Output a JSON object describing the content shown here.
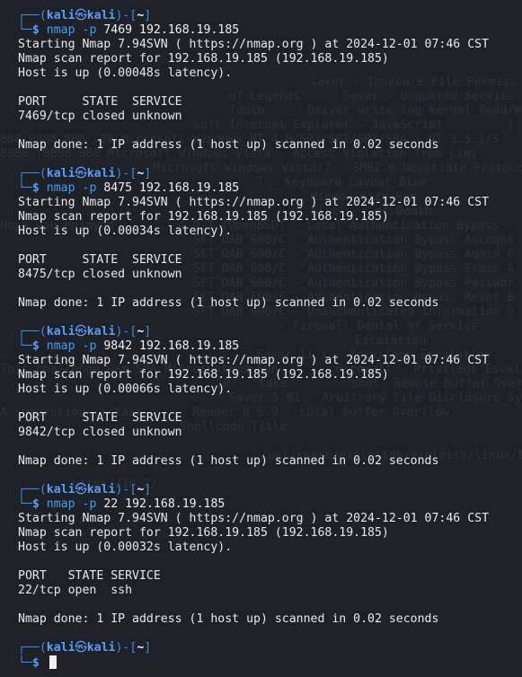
{
  "ghost": {
    "lines": [
      "saver - Insecure File Permiss",
      "of Legends      Saver - Unquoted Service Path",
      "Touch      Driver write_log Kernel Read/Wri",
      "soft Internet Explorer - JavaScript         | D",
      "888 8888 888 .30 Microsoft Windows NT 4.0/SP1/SP2/SP3/SP4 / NT 3.5.1/S",
      "8888 Y8888 888 Microsoft Windows Vista - Access Violation from Limi",
      "Microsoft Windows Vista/7 - SMB2.0 Negotiate Protoco",
      "7 - Keyboard Layout Blue              of S",
      "Window Size Rem",
      "- Blue     of Death",
      "Hope you enjoyed i       4.0.1 (OpenBSD) - Local Authentication Bypass",
      "SFT OAB 600/C - Authentication Bypass Account",
      "SFT OAB 600/C - Authentication Bypass Admin P",
      "SFT OAB 600/C - Authentication Bypass Erase A",
      "SFT OAB 600/C - Authentication Bypass Passwor",
      "SFT OAB 600/C - Authentication Bypass Reset B",
      "SFT OAB 600/C - Unauthenticated Information D",
      "- Firewall Denial of Service",
      "Escalation",
      "Saver 11.x - Privilege Escalation",
      "This challenge was SMA Microsystems Sun        Firewall - Privilege Escal",
      "10 - 'take         shot' Remote Buffer Overflow",
      "Saver 5.01 - Arbitrary File Disclosure Symlin",
      "A suggestion :: Yasr       Reader 0.6.9 - Local Buffer Overflow",
      "Shellcode Title",
      "/usr/share/exploitdb/exploits/linux/local/469",
      "http://10.2/"
    ]
  },
  "prompt": {
    "user": "kali",
    "at_symbol": "㉿",
    "host": "kali",
    "cwd": "~"
  },
  "blocks": [
    {
      "cmd_name": "nmap",
      "cmd_flag": "-p",
      "cmd_args": "7469 192.168.19.185",
      "output": [
        "Starting Nmap 7.94SVN ( https://nmap.org ) at 2024-12-01 07:46 CST",
        "Nmap scan report for 192.168.19.185 (192.168.19.185)",
        "Host is up (0.00048s latency).",
        "",
        "PORT     STATE  SERVICE",
        "7469/tcp closed unknown",
        "",
        "Nmap done: 1 IP address (1 host up) scanned in 0.02 seconds"
      ]
    },
    {
      "cmd_name": "nmap",
      "cmd_flag": "-p",
      "cmd_args": "8475 192.168.19.185",
      "output": [
        "Starting Nmap 7.94SVN ( https://nmap.org ) at 2024-12-01 07:46 CST",
        "Nmap scan report for 192.168.19.185 (192.168.19.185)",
        "Host is up (0.00034s latency).",
        "",
        "PORT     STATE  SERVICE",
        "8475/tcp closed unknown",
        "",
        "Nmap done: 1 IP address (1 host up) scanned in 0.02 seconds"
      ]
    },
    {
      "cmd_name": "nmap",
      "cmd_flag": "-p",
      "cmd_args": "9842 192.168.19.185",
      "output": [
        "Starting Nmap 7.94SVN ( https://nmap.org ) at 2024-12-01 07:46 CST",
        "Nmap scan report for 192.168.19.185 (192.168.19.185)",
        "Host is up (0.00066s latency).",
        "",
        "PORT     STATE  SERVICE",
        "9842/tcp closed unknown",
        "",
        "Nmap done: 1 IP address (1 host up) scanned in 0.02 seconds"
      ]
    },
    {
      "cmd_name": "nmap",
      "cmd_flag": "-p",
      "cmd_args": "22 192.168.19.185",
      "output": [
        "Starting Nmap 7.94SVN ( https://nmap.org ) at 2024-12-01 07:46 CST",
        "Nmap scan report for 192.168.19.185 (192.168.19.185)",
        "Host is up (0.00032s latency).",
        "",
        "PORT   STATE SERVICE",
        "22/tcp open  ssh",
        "",
        "Nmap done: 1 IP address (1 host up) scanned in 0.02 seconds"
      ]
    }
  ]
}
